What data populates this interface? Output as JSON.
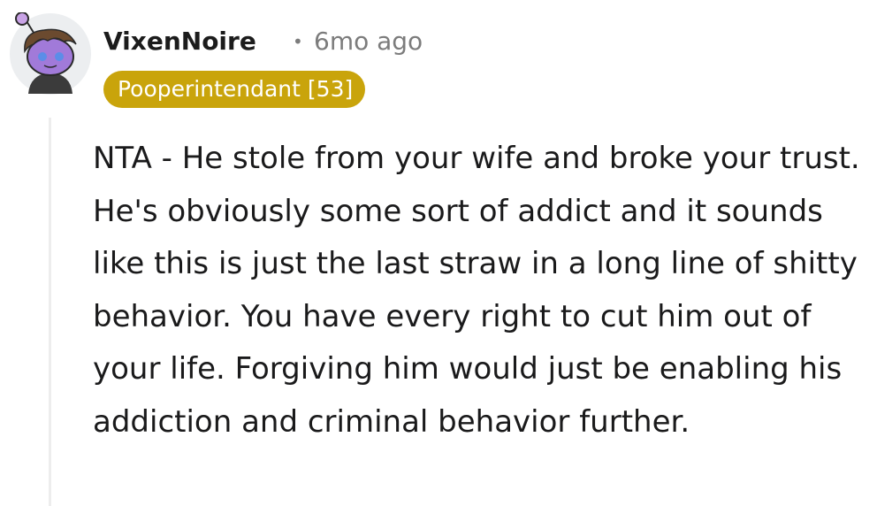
{
  "comment": {
    "username": "VixenNoire",
    "separator": "•",
    "timestamp": "6mo ago",
    "flair": "Pooperintendant [53]",
    "body": "NTA - He stole from your wife and broke your trust. He's obviously some sort of addict and it sounds like this is just the last straw in a long line of shitty behavior. You have every right to cut him out of your life. Forgiving him would just be enabling his addiction and criminal behavior further.",
    "avatar_icon": "snoo-avatar-icon",
    "flair_color": "#c9a40b"
  }
}
